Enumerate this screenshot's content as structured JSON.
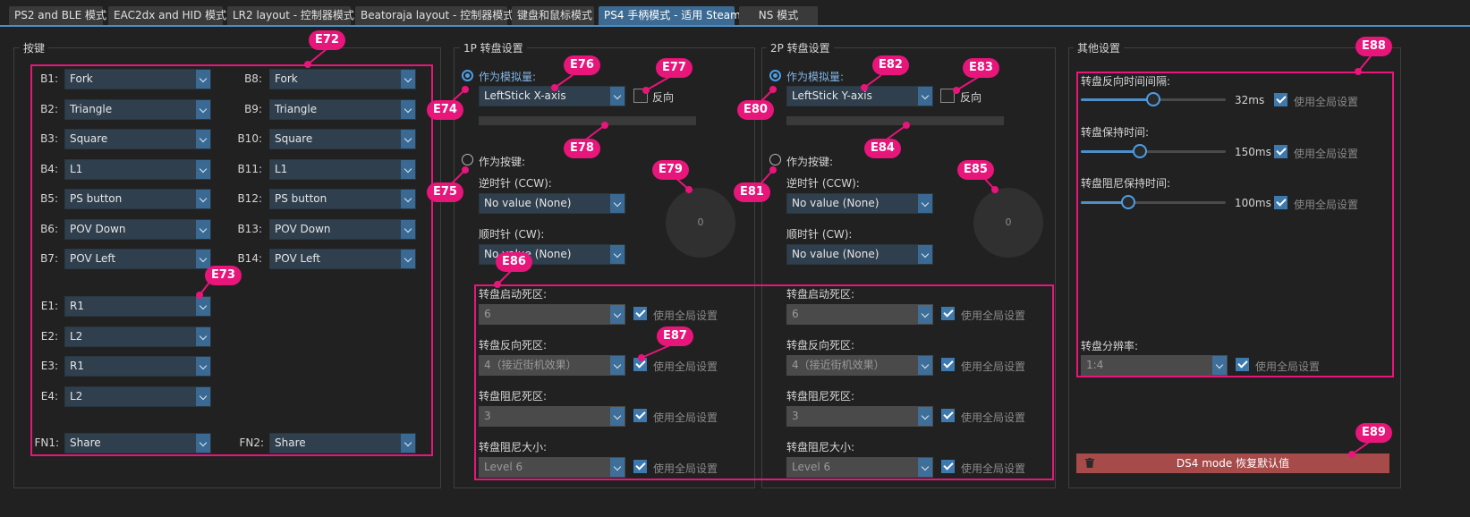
{
  "tabs": [
    {
      "label": "PS2 and BLE 模式"
    },
    {
      "label": "EAC2dx and HID 模式"
    },
    {
      "label": "LR2 layout - 控制器模式"
    },
    {
      "label": "Beatoraja layout - 控制器模式"
    },
    {
      "label": "键盘和鼠标模式"
    },
    {
      "label": "PS4 手柄模式 - 适用 Steam",
      "active": true
    },
    {
      "label": "NS 模式"
    }
  ],
  "buttons_group": {
    "title": "按键",
    "left": [
      {
        "label": "B1:",
        "value": "Fork"
      },
      {
        "label": "B2:",
        "value": "Triangle"
      },
      {
        "label": "B3:",
        "value": "Square"
      },
      {
        "label": "B4:",
        "value": "L1"
      },
      {
        "label": "B5:",
        "value": "PS button"
      },
      {
        "label": "B6:",
        "value": "POV Down"
      },
      {
        "label": "B7:",
        "value": "POV Left"
      }
    ],
    "right": [
      {
        "label": "B8:",
        "value": "Fork"
      },
      {
        "label": "B9:",
        "value": "Triangle"
      },
      {
        "label": "B10:",
        "value": "Square"
      },
      {
        "label": "B11:",
        "value": "L1"
      },
      {
        "label": "B12:",
        "value": "PS button"
      },
      {
        "label": "B13:",
        "value": "POV Down"
      },
      {
        "label": "B14:",
        "value": "POV Left"
      }
    ],
    "extra": [
      {
        "label": "E1:",
        "value": "R1"
      },
      {
        "label": "E2:",
        "value": "L2"
      },
      {
        "label": "E3:",
        "value": "R1"
      },
      {
        "label": "E4:",
        "value": "L2"
      }
    ],
    "fn": [
      {
        "label": "FN1:",
        "value": "Share"
      },
      {
        "label": "FN2:",
        "value": "Share"
      }
    ]
  },
  "tt1": {
    "title": "1P 转盘设置",
    "analog_label": "作为模拟量:",
    "analog_value": "LeftStick X-axis",
    "reverse_label": "反向",
    "button_label": "作为按键:",
    "ccw_label": "逆时针 (CCW):",
    "ccw_value": "No value (None)",
    "cw_label": "顺时针 (CW):",
    "cw_value": "No value (None)",
    "dial_value": "0"
  },
  "tt2": {
    "title": "2P 转盘设置",
    "analog_label": "作为模拟量:",
    "analog_value": "LeftStick Y-axis",
    "reverse_label": "反向",
    "button_label": "作为按键:",
    "ccw_label": "逆时针 (CCW):",
    "ccw_value": "No value (None)",
    "cw_label": "顺时针 (CW):",
    "cw_value": "No value (None)",
    "dial_value": "0"
  },
  "deadzones": {
    "use_global": "使用全局设置",
    "items": [
      {
        "label": "转盘启动死区:",
        "p1": "6",
        "p2": "6"
      },
      {
        "label": "转盘反向死区:",
        "p1": "4（接近街机效果）",
        "p2": "4（接近街机效果）"
      },
      {
        "label": "转盘阻尼死区:",
        "p1": "3",
        "p2": "3"
      },
      {
        "label": "转盘阻尼大小:",
        "p1": "Level 6",
        "p2": "Level 6"
      }
    ]
  },
  "other": {
    "title": "其他设置",
    "use_global": "使用全局设置",
    "sliders": [
      {
        "label": "转盘反向时间间隔:",
        "value": "32ms",
        "fraction": 0.5
      },
      {
        "label": "转盘保持时间:",
        "value": "150ms",
        "fraction": 0.41
      },
      {
        "label": "转盘阻尼保持时间:",
        "value": "100ms",
        "fraction": 0.33
      }
    ],
    "resolution_label": "转盘分辨率:",
    "resolution_value": "1:4",
    "reset_label": "DS4 mode  恢复默认值"
  },
  "annotations": [
    "E72",
    "E73",
    "E74",
    "E75",
    "E76",
    "E77",
    "E78",
    "E79",
    "E80",
    "E81",
    "E82",
    "E83",
    "E84",
    "E85",
    "E86",
    "E87",
    "E88",
    "E89"
  ]
}
